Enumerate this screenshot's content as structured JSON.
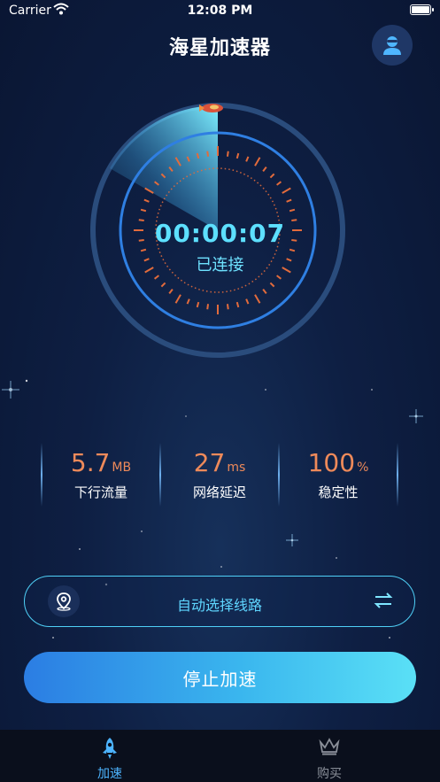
{
  "status_bar": {
    "carrier": "Carrier",
    "time": "12:08 PM"
  },
  "header": {
    "title": "海星加速器"
  },
  "dial": {
    "timer": "00:00:07",
    "status": "已连接"
  },
  "stats": [
    {
      "value": "5.7",
      "unit": "MB",
      "label": "下行流量"
    },
    {
      "value": "27",
      "unit": "ms",
      "label": "网络延迟"
    },
    {
      "value": "100",
      "unit": "%",
      "label": "稳定性"
    }
  ],
  "route": {
    "label": "自动选择线路"
  },
  "action": {
    "stop_label": "停止加速"
  },
  "tabs": [
    {
      "label": "加速",
      "icon": "rocket-icon",
      "active": true
    },
    {
      "label": "购买",
      "icon": "crown-icon",
      "active": false
    }
  ],
  "colors": {
    "accent": "#5de0ff",
    "stat": "#ee8a5a",
    "active_tab": "#4db4ff",
    "inactive_tab": "#8a8f99"
  }
}
